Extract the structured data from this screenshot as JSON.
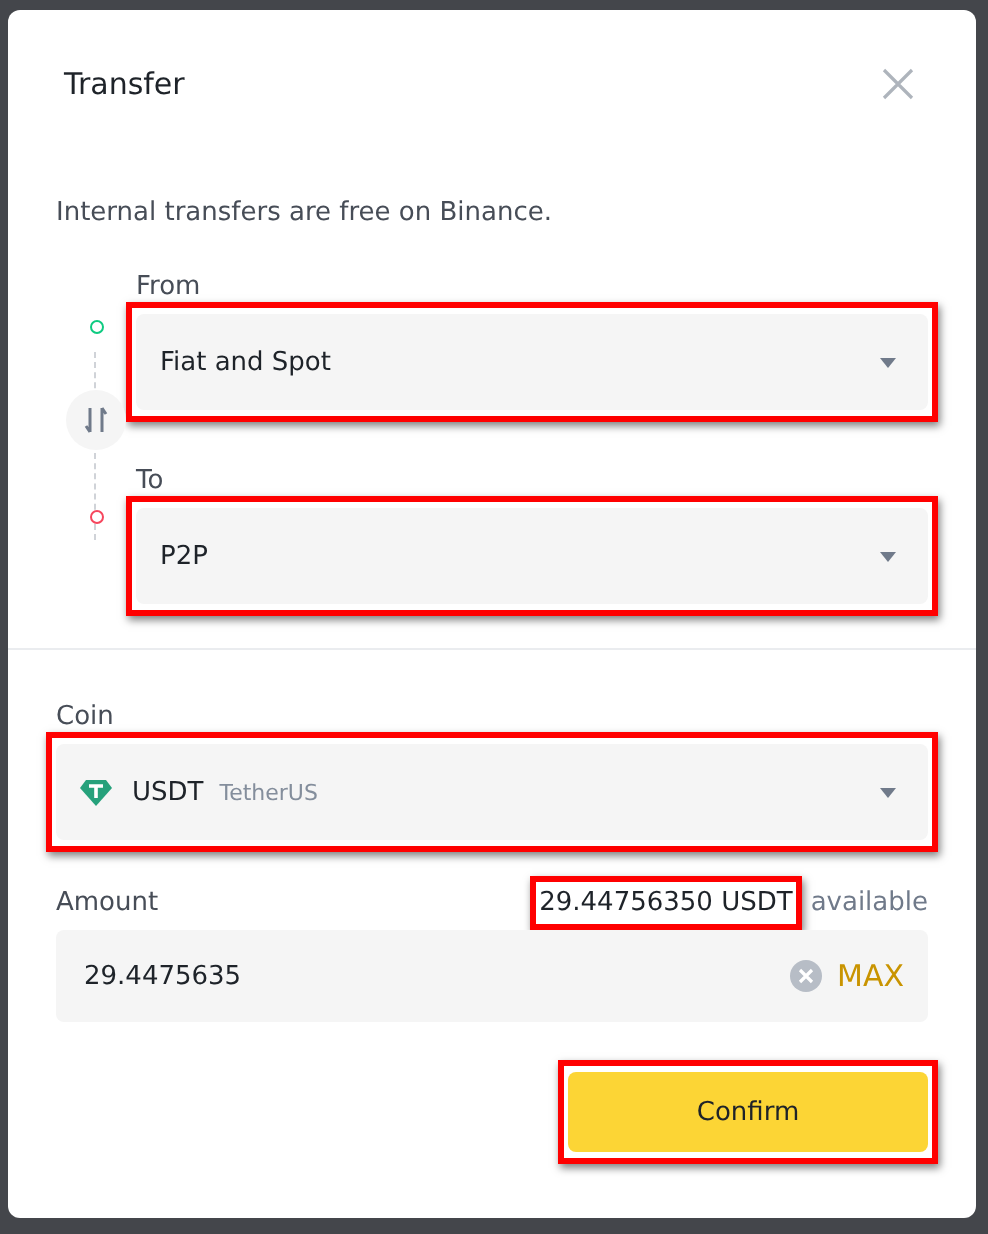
{
  "dialog": {
    "title": "Transfer",
    "note": "Internal transfers are free on Binance."
  },
  "from": {
    "label": "From",
    "value": "Fiat and Spot",
    "highlighted": true
  },
  "to": {
    "label": "To",
    "value": "P2P",
    "highlighted": true
  },
  "coin": {
    "label": "Coin",
    "symbol": "USDT",
    "name": "TetherUS",
    "highlighted": true
  },
  "amount": {
    "label": "Amount",
    "available_amount": "29.44756350 USDT",
    "available_suffix": "available",
    "available_highlighted": true,
    "value": "29.4475635",
    "max": "MAX"
  },
  "confirm": {
    "label": "Confirm",
    "highlighted": true
  }
}
